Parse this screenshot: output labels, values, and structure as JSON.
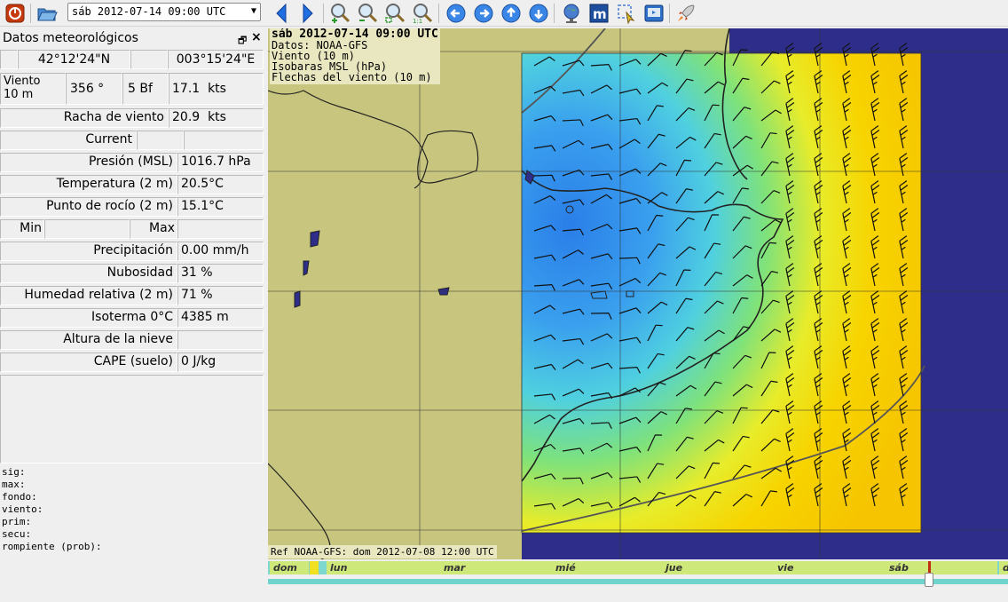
{
  "toolbar": {
    "datetime_value": "sáb 2012-07-14 09:00 UTC",
    "icons": [
      "power-icon",
      "open-folder-icon",
      "prev-arrow-icon",
      "next-arrow-icon",
      "zoom-in-icon",
      "zoom-out-icon",
      "zoom-fit-icon",
      "zoom-1to1-icon",
      "pan-left-icon",
      "pan-right-icon",
      "pan-up-icon",
      "pan-down-icon",
      "globe-icon",
      "meteo-m-icon",
      "selection-icon",
      "export-icon",
      "rocket-icon"
    ]
  },
  "panel": {
    "title": "Datos meteorológicos",
    "lat": "42°12'24\"N",
    "lon": "003°15'24\"E",
    "wind": {
      "label_line1": "Viento",
      "label_line2": "10 m",
      "direction": "356 °",
      "beaufort": "5 Bf",
      "speed": "17.1  kts"
    },
    "rows": {
      "gust": {
        "label": "Racha de viento",
        "value": "20.9  kts"
      },
      "current": {
        "label": "Current"
      },
      "pressure": {
        "label": "Presión (MSL)",
        "value": "1016.7 hPa"
      },
      "temperature": {
        "label": "Temperatura (2 m)",
        "value": "20.5°C"
      },
      "dewpoint": {
        "label": "Punto de rocío (2 m)",
        "value": "15.1°C"
      },
      "min": {
        "label": "Min"
      },
      "max": {
        "label": "Max"
      },
      "precip": {
        "label": "Precipitación",
        "value": "0.00 mm/h"
      },
      "cloud": {
        "label": "Nubosidad",
        "value": "31 %"
      },
      "humidity": {
        "label": "Humedad relativa (2 m)",
        "value": "71 %"
      },
      "isotherm": {
        "label": "Isoterma 0°C",
        "value": "4385 m"
      },
      "snow": {
        "label": "Altura de la nieve",
        "value": ""
      },
      "cape": {
        "label": "CAPE (suelo)",
        "value": "0 J/kg"
      }
    },
    "wave_lines": [
      "sig:",
      "max:",
      "fondo:",
      "viento:",
      "prim:",
      "secu:",
      "rompiente (prob):"
    ]
  },
  "map": {
    "info_title": "sáb 2012-07-14 09:00 UTC",
    "info_lines": [
      "Datos: NOAA-GFS",
      "Viento (10 m)",
      "Isobaras MSL (hPa)",
      "Flechas del viento (10 m)"
    ],
    "ref": "Ref NOAA-GFS: dom 2012-07-08 12:00 UTC",
    "colors": {
      "sea": "#2e2e8a",
      "land": "#c8c67e"
    }
  },
  "timeline": {
    "days": [
      "dom",
      "lun",
      "mar",
      "mié",
      "jue",
      "vie",
      "sáb",
      "d"
    ]
  }
}
